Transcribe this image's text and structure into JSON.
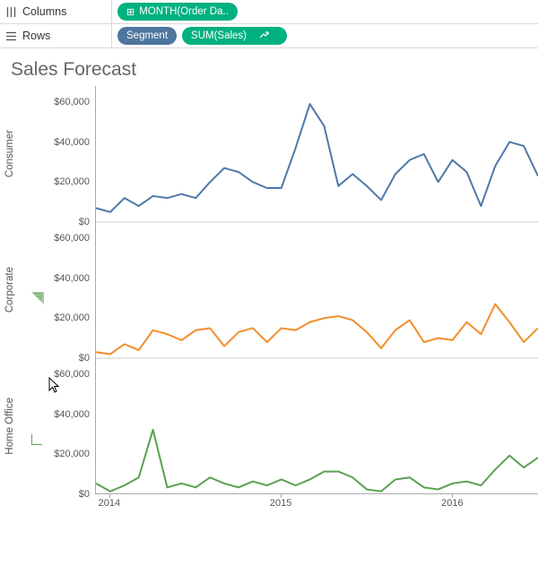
{
  "shelves": {
    "columns": {
      "label": "Columns",
      "pill": "MONTH(Order Da..",
      "pill_icon": "⊞"
    },
    "rows": {
      "label": "Rows",
      "pill_segment": "Segment",
      "pill_measure": "SUM(Sales)",
      "pill_measure_icon": "↗"
    }
  },
  "title": "Sales Forecast",
  "segments": [
    "Consumer",
    "Corporate",
    "Home Office"
  ],
  "yticks": [
    "$0",
    "$20,000",
    "$40,000",
    "$60,000"
  ],
  "xticks": [
    "2014",
    "2015",
    "2016"
  ],
  "chart_data": {
    "type": "line",
    "xlabel": "MONTH(Order Date)",
    "ylabel": "SUM(Sales)",
    "ylim": [
      0,
      68000
    ],
    "x_start": "2013-12",
    "x_interval": "month",
    "xtick_positions_index": [
      1,
      13,
      25
    ],
    "colors": {
      "Consumer": "#4e79a7",
      "Corporate": "#f28e2b",
      "Home Office": "#59a14f"
    },
    "series": [
      {
        "name": "Consumer",
        "values": [
          7000,
          5000,
          12000,
          8000,
          13000,
          12000,
          14000,
          12000,
          20000,
          27000,
          25000,
          20000,
          17000,
          17000,
          37000,
          59000,
          48000,
          18000,
          24000,
          18000,
          11000,
          24000,
          31000,
          34000,
          20000,
          31000,
          25000,
          8000,
          28000,
          40000,
          38000,
          23000
        ]
      },
      {
        "name": "Corporate",
        "values": [
          3000,
          2000,
          7000,
          4000,
          14000,
          12000,
          9000,
          14000,
          15000,
          6000,
          13000,
          15000,
          8000,
          15000,
          14000,
          18000,
          20000,
          21000,
          19000,
          13000,
          5000,
          14000,
          19000,
          8000,
          10000,
          9000,
          18000,
          12000,
          27000,
          18000,
          8000,
          15000
        ]
      },
      {
        "name": "Home Office",
        "values": [
          5000,
          1000,
          4000,
          8000,
          32000,
          3000,
          5000,
          3000,
          8000,
          5000,
          3000,
          6000,
          4000,
          7000,
          4000,
          7000,
          11000,
          11000,
          8000,
          2000,
          1000,
          7000,
          8000,
          3000,
          2000,
          5000,
          6000,
          4000,
          12000,
          19000,
          13000,
          18000
        ]
      }
    ]
  }
}
